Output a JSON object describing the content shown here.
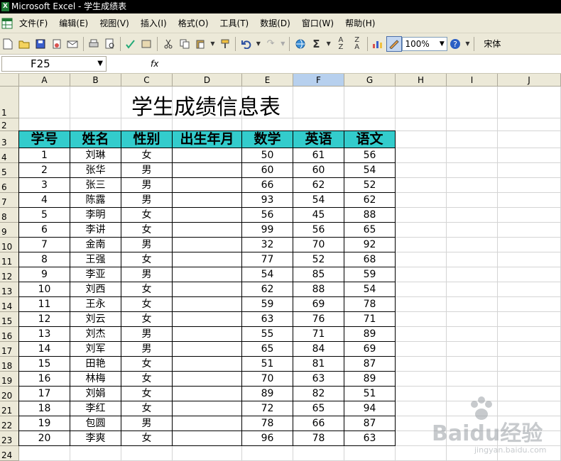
{
  "window": {
    "title": "Microsoft Excel - 学生成绩表"
  },
  "menu": [
    "文件(F)",
    "编辑(E)",
    "视图(V)",
    "插入(I)",
    "格式(O)",
    "工具(T)",
    "数据(D)",
    "窗口(W)",
    "帮助(H)"
  ],
  "toolbar": {
    "zoom": "100%",
    "font": "宋体"
  },
  "formula": {
    "namebox": "F25",
    "fx": "fx"
  },
  "columns": [
    "A",
    "B",
    "C",
    "D",
    "E",
    "F",
    "G",
    "H",
    "I",
    "J"
  ],
  "selected_column": "F",
  "rows": [
    "1",
    "2",
    "3",
    "4",
    "5",
    "6",
    "7",
    "8",
    "9",
    "10",
    "11",
    "12",
    "13",
    "14",
    "15",
    "16",
    "17",
    "18",
    "19",
    "20",
    "21",
    "22",
    "23",
    "24"
  ],
  "sheet": {
    "title": "学生成绩信息表",
    "headers": [
      "学号",
      "姓名",
      "性别",
      "出生年月",
      "数学",
      "英语",
      "语文"
    ],
    "records": [
      [
        "1",
        "刘琳",
        "女",
        "",
        "50",
        "61",
        "56"
      ],
      [
        "2",
        "张华",
        "男",
        "",
        "60",
        "60",
        "54"
      ],
      [
        "3",
        "张三",
        "男",
        "",
        "66",
        "62",
        "52"
      ],
      [
        "4",
        "陈露",
        "男",
        "",
        "93",
        "54",
        "62"
      ],
      [
        "5",
        "李明",
        "女",
        "",
        "56",
        "45",
        "88"
      ],
      [
        "6",
        "李讲",
        "女",
        "",
        "99",
        "56",
        "65"
      ],
      [
        "7",
        "金南",
        "男",
        "",
        "32",
        "70",
        "92"
      ],
      [
        "8",
        "王强",
        "女",
        "",
        "77",
        "52",
        "68"
      ],
      [
        "9",
        "李亚",
        "男",
        "",
        "54",
        "85",
        "59"
      ],
      [
        "10",
        "刘西",
        "女",
        "",
        "62",
        "88",
        "54"
      ],
      [
        "11",
        "王永",
        "女",
        "",
        "59",
        "69",
        "78"
      ],
      [
        "12",
        "刘云",
        "女",
        "",
        "63",
        "76",
        "71"
      ],
      [
        "13",
        "刘杰",
        "男",
        "",
        "55",
        "71",
        "89"
      ],
      [
        "14",
        "刘军",
        "男",
        "",
        "65",
        "84",
        "69"
      ],
      [
        "15",
        "田艳",
        "女",
        "",
        "51",
        "81",
        "87"
      ],
      [
        "16",
        "林梅",
        "女",
        "",
        "70",
        "63",
        "89"
      ],
      [
        "17",
        "刘娟",
        "女",
        "",
        "89",
        "82",
        "51"
      ],
      [
        "18",
        "李红",
        "女",
        "",
        "72",
        "65",
        "94"
      ],
      [
        "19",
        "包圆",
        "男",
        "",
        "78",
        "66",
        "87"
      ],
      [
        "20",
        "李爽",
        "女",
        "",
        "96",
        "78",
        "63"
      ]
    ]
  },
  "watermark": {
    "text": "Baidu经验",
    "url": "jingyan.baidu.com"
  },
  "colors": {
    "header_fill": "#33cccc",
    "chrome": "#ece9d8",
    "selected_header": "#b7d0ee"
  }
}
